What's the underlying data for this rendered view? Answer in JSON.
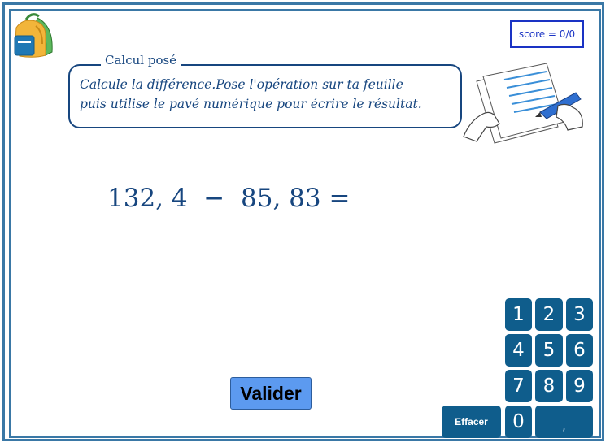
{
  "score": {
    "label": "score = 0/0"
  },
  "instructions": {
    "title": "Calcul posé",
    "line1": "Calcule la différence.Pose l'opération sur ta feuille",
    "line2": "puis utilise le pavé numérique pour écrire le résultat."
  },
  "exercise": {
    "expression": "132, 4  −  85, 83 ="
  },
  "validate": {
    "label": "Valider"
  },
  "keypad": {
    "keys": [
      "1",
      "2",
      "3",
      "4",
      "5",
      "6",
      "7",
      "8",
      "9",
      "0",
      ","
    ],
    "clear_label": "Effacer"
  },
  "colors": {
    "frame": "#3a78a6",
    "key": "#0f5d8c",
    "button": "#5c9af0",
    "text": "#17467f"
  },
  "icons": {
    "top_left": "backpack-icon",
    "illustration": "writing-on-paper-icon"
  }
}
